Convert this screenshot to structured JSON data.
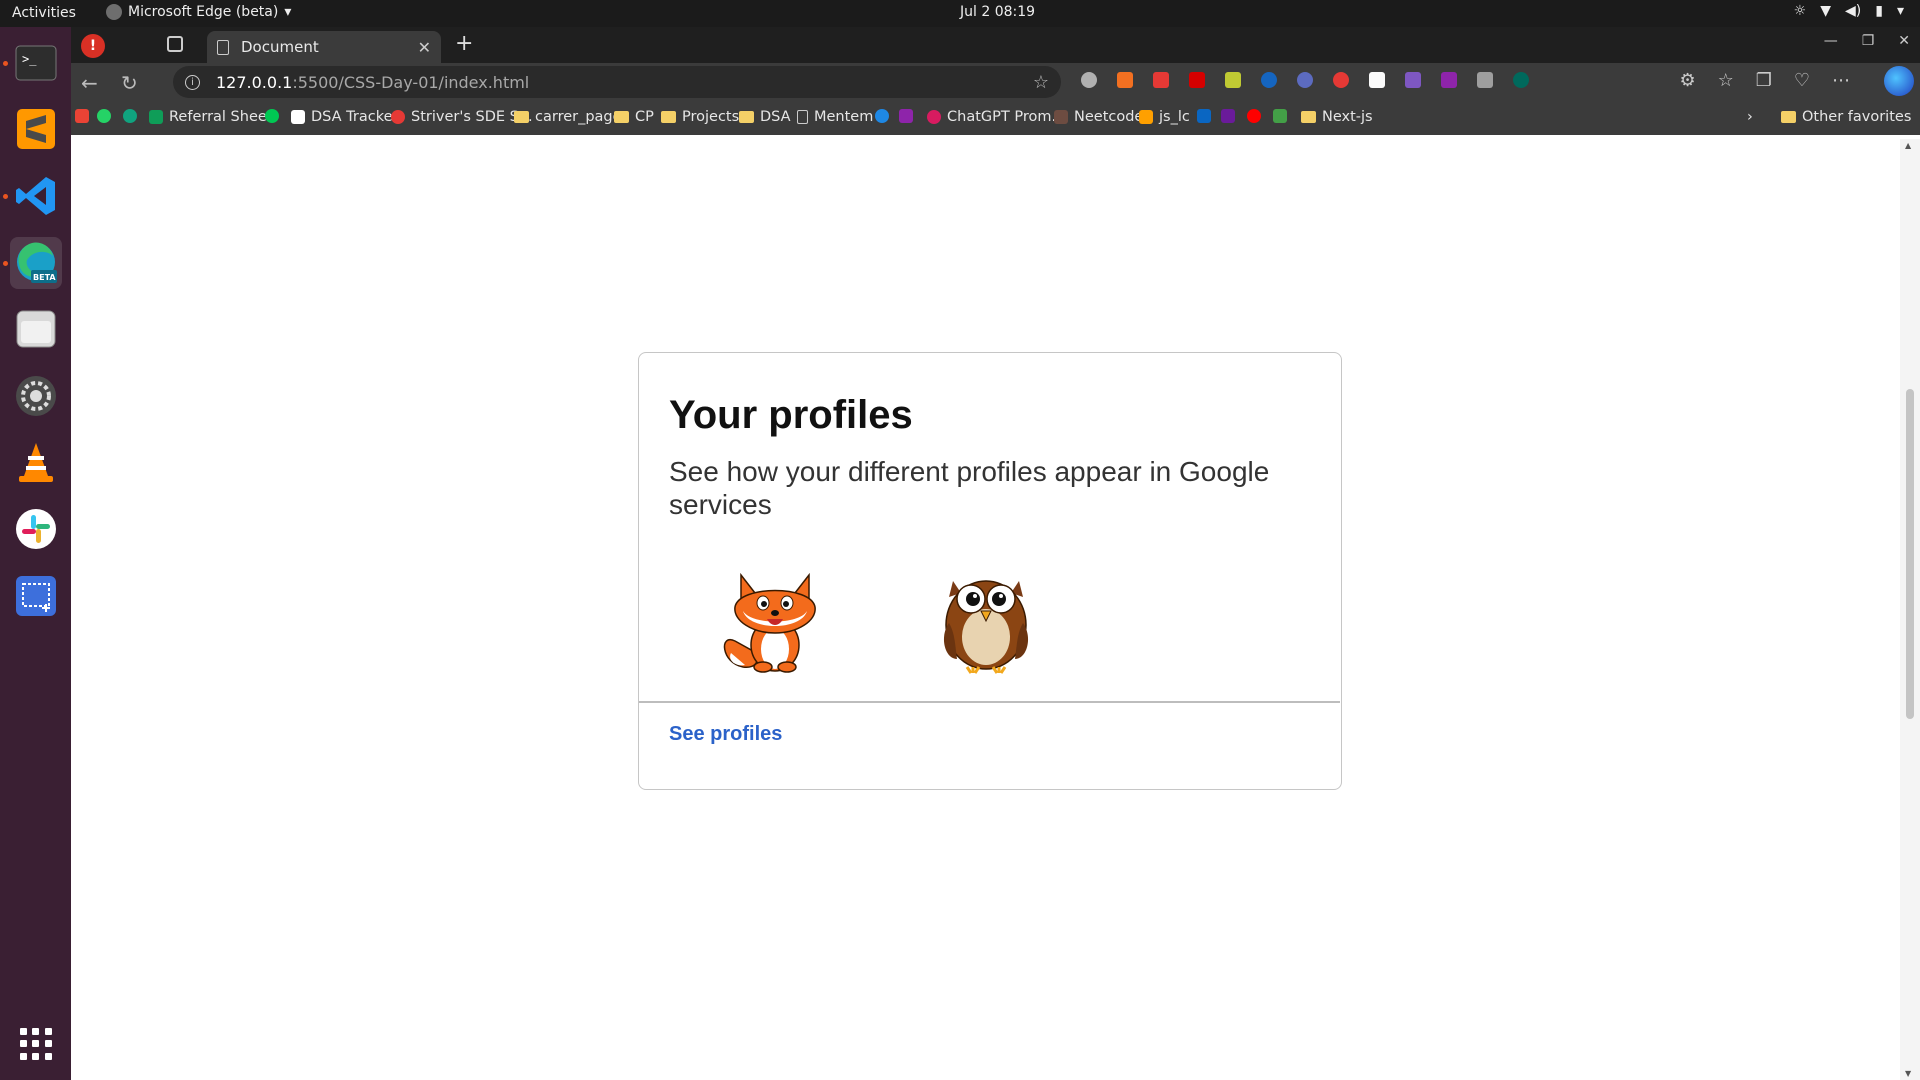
{
  "os_topbar": {
    "activities_label": "Activities",
    "app_menu_label": "Microsoft Edge (beta)",
    "clock": "Jul 2  08:19"
  },
  "dock": {
    "items": [
      "terminal-icon",
      "sublime-text-icon",
      "vscode-icon",
      "edge-beta-icon",
      "files-icon",
      "settings-icon",
      "vlc-icon",
      "slack-icon",
      "screenshot-icon",
      "app-grid-icon"
    ],
    "edge_badge": "BETA"
  },
  "browser": {
    "tab_title": "Document",
    "address": {
      "host": "127.0.0.1",
      "path": ":5500/CSS-Day-01/index.html"
    },
    "bookmarks": [
      {
        "label": "Referral Sheet",
        "kind": "site"
      },
      {
        "label": "DSA Tracker",
        "kind": "site"
      },
      {
        "label": "Striver's SDE S...",
        "kind": "site"
      },
      {
        "label": "carrer_page",
        "kind": "folder"
      },
      {
        "label": "CP",
        "kind": "folder"
      },
      {
        "label": "Projects",
        "kind": "folder"
      },
      {
        "label": "DSA",
        "kind": "folder"
      },
      {
        "label": "Mentem",
        "kind": "page"
      },
      {
        "label": "ChatGPT Prom...",
        "kind": "site"
      },
      {
        "label": "Neetcode",
        "kind": "site"
      },
      {
        "label": "js_lc",
        "kind": "site"
      },
      {
        "label": "Next-js",
        "kind": "folder"
      },
      {
        "label": "Other favorites",
        "kind": "folder"
      }
    ]
  },
  "page": {
    "card": {
      "title": "Your profiles",
      "subtitle": "See how your different profiles appear in Google services",
      "avatars": [
        "fox-avatar",
        "owl-avatar"
      ],
      "link_label": "See profiles"
    }
  },
  "colors": {
    "link": "#2b62c9",
    "card_border": "#c6c6c6",
    "dock_bg": "#3a1f33",
    "accent_dot": "#e95420"
  }
}
